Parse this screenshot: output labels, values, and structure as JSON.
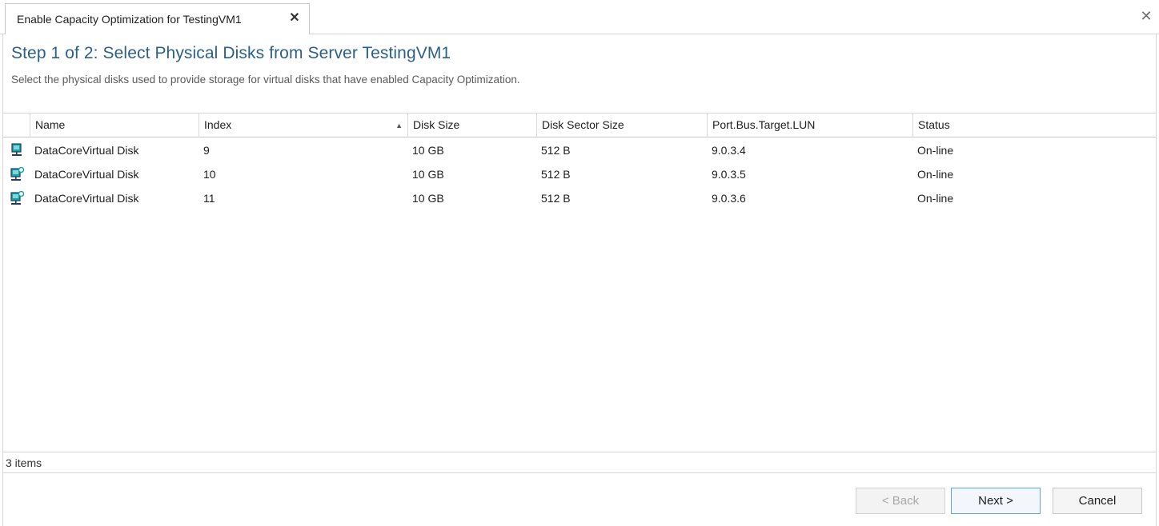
{
  "tab": {
    "title": "Enable Capacity Optimization for TestingVM1",
    "close_glyph": "✕"
  },
  "window": {
    "close_glyph": "✕"
  },
  "step": {
    "title": "Step 1 of 2: Select Physical Disks from Server TestingVM1",
    "description": "Select the physical disks used to provide storage for virtual disks that have enabled Capacity Optimization."
  },
  "grid": {
    "columns": [
      {
        "key": "name",
        "label": "Name"
      },
      {
        "key": "index",
        "label": "Index",
        "sorted": "ascending",
        "sort_glyph": "▲"
      },
      {
        "key": "disk_size",
        "label": "Disk Size"
      },
      {
        "key": "sector_size",
        "label": "Disk Sector Size"
      },
      {
        "key": "lun",
        "label": "Port.Bus.Target.LUN"
      },
      {
        "key": "status",
        "label": "Status"
      }
    ],
    "rows": [
      {
        "icon": "physical-disk-icon",
        "name": "DataCoreVirtual Disk",
        "index": "9",
        "disk_size": "10 GB",
        "sector_size": "512 B",
        "lun": "9.0.3.4",
        "status": "On-line"
      },
      {
        "icon": "physical-disk-shared-icon",
        "name": "DataCoreVirtual Disk",
        "index": "10",
        "disk_size": "10 GB",
        "sector_size": "512 B",
        "lun": "9.0.3.5",
        "status": "On-line"
      },
      {
        "icon": "physical-disk-shared-icon",
        "name": "DataCoreVirtual Disk",
        "index": "11",
        "disk_size": "10 GB",
        "sector_size": "512 B",
        "lun": "9.0.3.6",
        "status": "On-line"
      }
    ]
  },
  "status_bar": {
    "text": "3 items"
  },
  "buttons": {
    "back": "< Back",
    "next": "Next >",
    "cancel": "Cancel"
  },
  "colors": {
    "title": "#2c5f8a",
    "icon_teal": "#1aa0a8",
    "icon_dark": "#1f3f5c",
    "next_border": "#5fa5d8"
  }
}
